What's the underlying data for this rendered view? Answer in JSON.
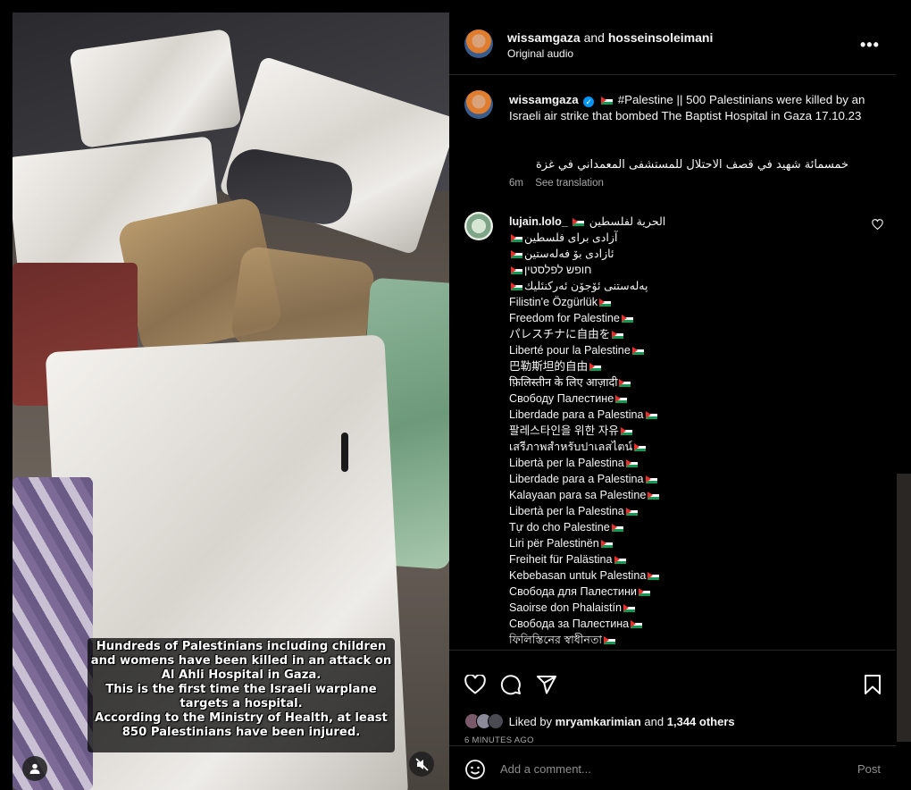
{
  "media": {
    "caption_lines": [
      "Hundreds of Palestinians including children",
      "and womens have been killed in an attack on",
      "Al Ahli Hospital in Gaza.",
      "This is the first time the Israeli warplane",
      "targets a hospital.",
      "According to the Ministry of Health, at least",
      "850 Palestinians have been injured."
    ]
  },
  "header": {
    "author": "wissamgaza",
    "joiner": "and",
    "collaborator": "hosseinsoleimani",
    "audio": "Original audio"
  },
  "post": {
    "username": "wissamgaza",
    "caption": "#Palestine || 500 Palestinians were killed by an Israeli air strike that bombed The Baptist Hospital in Gaza 17.10.23",
    "arabic_caption": "خمسمائة شهيد في قصف الاحتلال للمستشفى المعمداني في غزة",
    "time": "6m",
    "see_translation": "See translation"
  },
  "comment": {
    "username": "lujain.lolo_",
    "first_text": "الحرية لفلسطين",
    "lines": [
      "آزادی برای فلسطین",
      "ئازادی بۆ فەلەستین",
      "חופש לפלסטין",
      "پەلەستنی ئۆجۆن ئەرکنئلیك",
      "Filistin'e Özgürlük",
      "Freedom for Palestine",
      "パレスチナに自由を",
      "Liberté pour la Palestine",
      "巴勒斯坦的自由",
      "फ़िलिस्तीन के लिए आज़ादी",
      "Свободу Палестине",
      "Liberdade para a Palestina",
      "팔레스타인을 위한 자유",
      "เสรีภาพสำหรับปาเลสไตน์",
      "Libertà per la Palestina",
      "Liberdade para a Palestina",
      "Kalayaan para sa Palestine",
      "Libertà per la Palestina",
      "Tự do cho Palestine",
      "Liri për Palestinën",
      "Freiheit für Palästina",
      "Kebebasan untuk Palestina",
      "Свобода для Палестини",
      "Saoirse don Phalaistín",
      "Свобода за Палестина",
      "ফিলিস্তিনের স্বাধীনতা"
    ]
  },
  "likes": {
    "prefix": "Liked by",
    "user": "mryamkarimian",
    "joiner": "and",
    "others": "1,344 others",
    "time_ago": "6 MINUTES AGO"
  },
  "add_comment": {
    "placeholder": "Add a comment...",
    "post_label": "Post"
  },
  "colors": {
    "background": "#000000",
    "text": "#f5f5f5",
    "muted": "#a8a8a8",
    "verified": "#0095f6",
    "divider": "#262626"
  },
  "icons": [
    "user-tag-icon",
    "mute-icon",
    "more-options-icon",
    "verified-badge-icon",
    "heart-icon",
    "comment-icon",
    "share-icon",
    "bookmark-icon",
    "emoji-icon",
    "palestine-flag-icon"
  ]
}
